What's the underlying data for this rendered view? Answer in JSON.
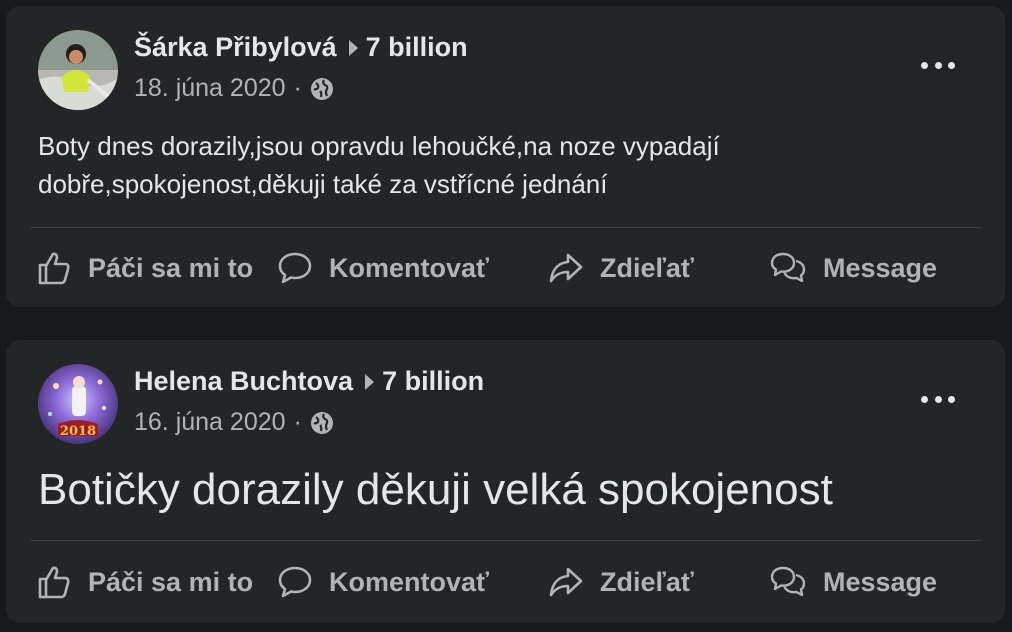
{
  "posts": [
    {
      "author": "Šárka Přibylová",
      "audience": "7 billion",
      "date": "18. júna 2020",
      "separator": "·",
      "text": "Boty dnes dorazily,jsou opravdu lehoučké,na noze vypadají dobře,spokojenost,děkuji také za vstřícné jednání",
      "avatar_icon": "profile-photo"
    },
    {
      "author": "Helena Buchtova",
      "audience": "7 billion",
      "date": "16. júna 2020",
      "separator": "·",
      "text": "Botičky dorazily děkuji velká spokojenost",
      "avatar_icon": "profile-photo"
    }
  ],
  "actions": {
    "like": "Páči sa mi to",
    "comment": "Komentovať",
    "share": "Zdieľať",
    "message": "Message"
  },
  "colors": {
    "background": "#18191a",
    "card": "#242526",
    "primary_text": "#e4e6eb",
    "secondary_text": "#b0b3b8",
    "divider": "#3e4042"
  }
}
